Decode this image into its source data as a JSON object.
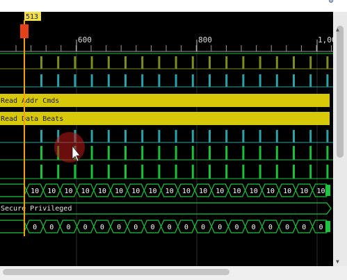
{
  "cursor": {
    "label": "513",
    "color": "#f2a20c"
  },
  "ruler": {
    "ticks": [
      "600",
      "800",
      "1,00"
    ]
  },
  "transactions": [
    {
      "label": "Read Addr Cmds",
      "color": "#d8c80a"
    },
    {
      "label": "Read Data Beats",
      "color": "#d8c80a"
    }
  ],
  "bus_rows": [
    {
      "value": "10",
      "count": 18
    },
    {
      "value": "0",
      "count": 18
    }
  ],
  "prot_label": "Secure Privileged",
  "colors": {
    "background": "#000000",
    "gridline": "#2e2e2e",
    "green": "#17c23a",
    "teal": "#2aa3a8",
    "olive": "#7e8e1a",
    "bus": "#19c63e"
  },
  "icons": {
    "top_right": "gear-icon",
    "scroll_up": "triangle-up-icon",
    "scroll_down": "triangle-down-icon"
  }
}
